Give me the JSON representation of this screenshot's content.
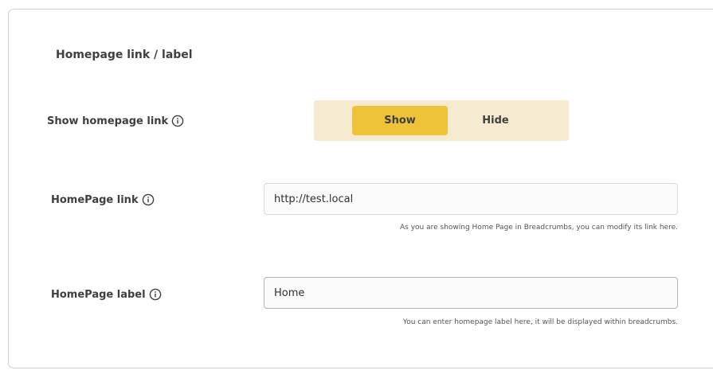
{
  "section": {
    "title": "Homepage link / label"
  },
  "show_homepage_link": {
    "label": "Show homepage link",
    "options": [
      "Show",
      "Hide"
    ],
    "selected": "Show"
  },
  "homepage_link": {
    "label": "HomePage link",
    "value": "http://test.local",
    "help": "As you are showing Home Page in Breadcrumbs, you can modify its link here."
  },
  "homepage_label": {
    "label": "HomePage label",
    "value": "Home",
    "help": "You can enter homepage label here, it will be displayed within breadcrumbs."
  },
  "icons": {
    "info": "info-circle-icon"
  },
  "colors": {
    "toggle_bg": "#f6ead0",
    "toggle_active": "#efc339",
    "border": "#cfcfcf"
  }
}
